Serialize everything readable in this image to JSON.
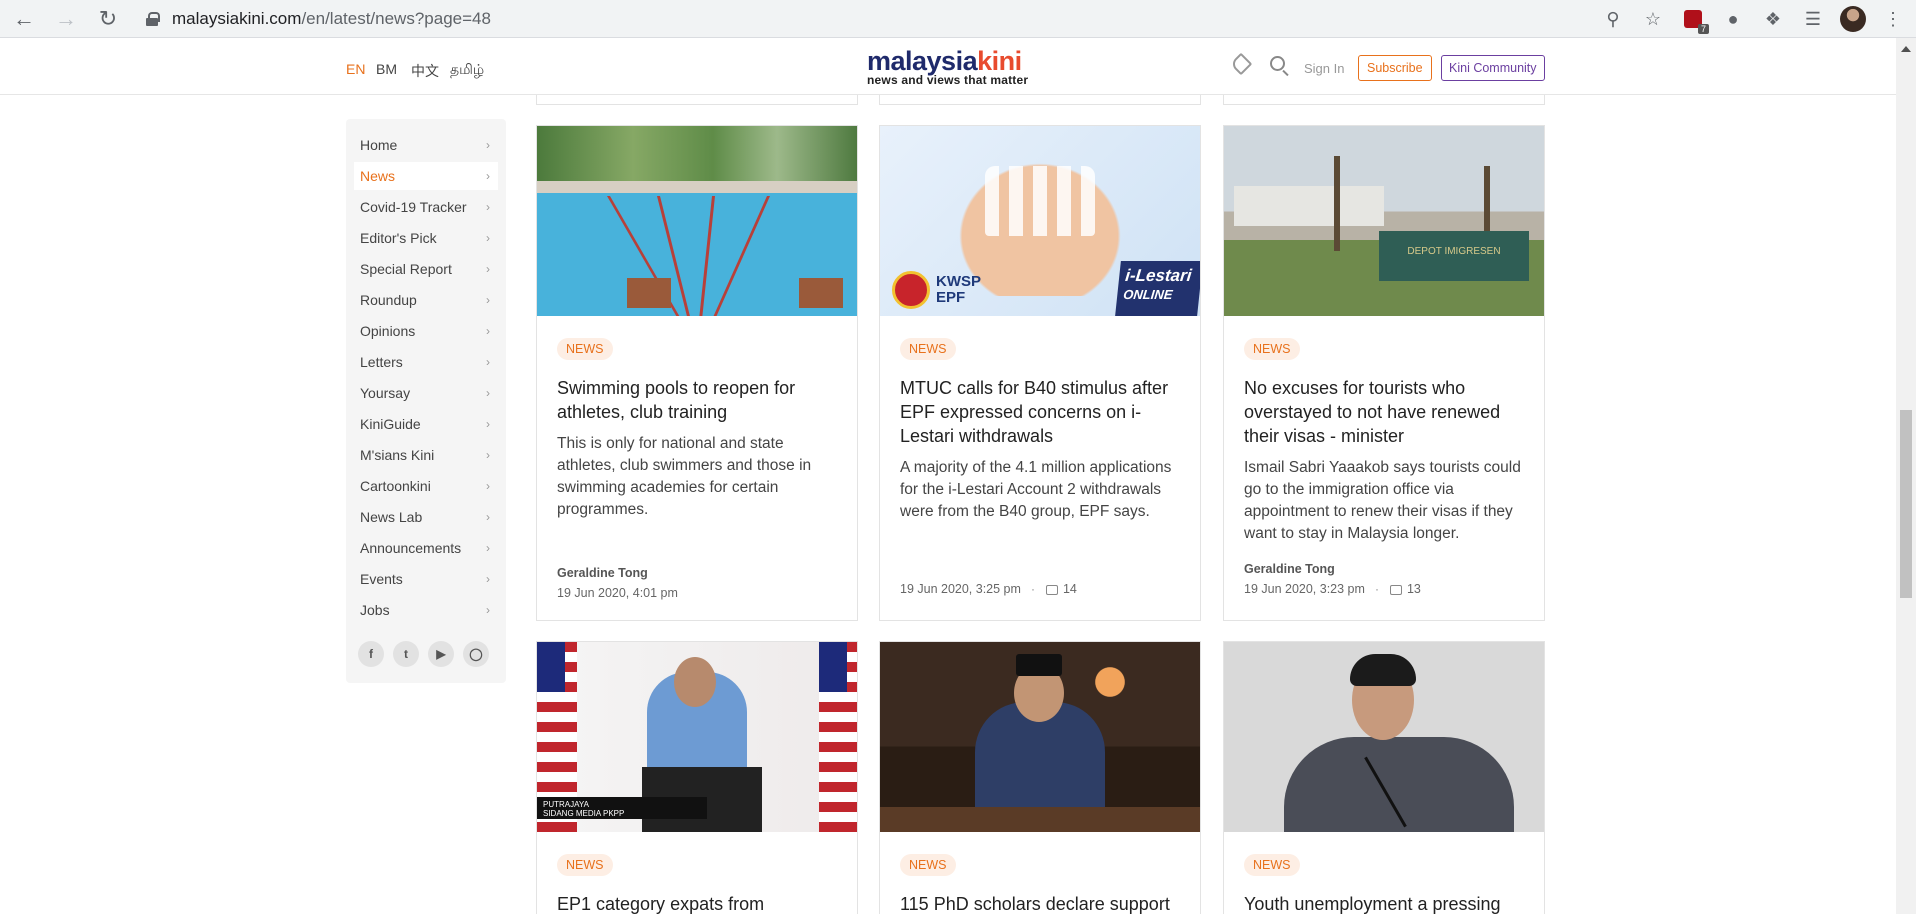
{
  "browser": {
    "url_domain": "malaysiakini.com",
    "url_path": "/en/latest/news?page=48",
    "ext_badge": "7"
  },
  "header": {
    "langs": [
      "EN",
      "BM",
      "中文",
      "தமிழ்"
    ],
    "logo_left": "malaysia",
    "logo_right": "kini",
    "tagline": "news and views that matter",
    "signin": "Sign In",
    "subscribe": "Subscribe",
    "community": "Kini Community"
  },
  "sidebar": {
    "items": [
      "Home",
      "News",
      "Covid-19 Tracker",
      "Editor's Pick",
      "Special Report",
      "Roundup",
      "Opinions",
      "Letters",
      "Yoursay",
      "KiniGuide",
      "M'sians Kini",
      "Cartoonkini",
      "News Lab",
      "Announcements",
      "Events",
      "Jobs"
    ],
    "active_item": "News",
    "social": [
      "facebook-icon",
      "twitter-icon",
      "youtube-icon",
      "instagram-icon"
    ]
  },
  "cards": [
    {
      "badge": "NEWS",
      "title": "Swimming pools to reopen for athletes, club training",
      "desc": "This is only for national and state athletes, club swimmers and those in swimming academies for certain programmes.",
      "author": "Geraldine Tong",
      "date": "19 Jun 2020, 4:01 pm"
    },
    {
      "badge": "NEWS",
      "title": "MTUC calls for B40 stimulus after EPF expressed concerns on i-Lestari withdrawals",
      "desc": "A majority of the 4.1 million applications for the i-Lestari Account 2 withdrawals were from the B40 group, EPF says.",
      "author": "",
      "date": "19 Jun 2020, 3:25 pm",
      "comments": "14",
      "img_kwsp": "KWSP",
      "img_epf": "EPF",
      "img_ilestari": "i-Lestari",
      "img_online": "ONLINE"
    },
    {
      "badge": "NEWS",
      "title": "No excuses for tourists who overstayed to not have renewed their visas - minister",
      "desc": "Ismail Sabri Yaaakob says tourists could go to the immigration office via appointment to renew their visas if they want to stay in Malaysia longer.",
      "author": "Geraldine Tong",
      "date": "19 Jun 2020, 3:23 pm",
      "comments": "13",
      "img_depot": "DEPOT IMIGRESEN"
    },
    {
      "badge": "NEWS",
      "title": "EP1 category expats from",
      "img_caption": "PUTRAJAYA",
      "img_caption2": "SIDANG MEDIA PKPP"
    },
    {
      "badge": "NEWS",
      "title": "115 PhD scholars declare support"
    },
    {
      "badge": "NEWS",
      "title": "Youth unemployment a pressing"
    }
  ]
}
